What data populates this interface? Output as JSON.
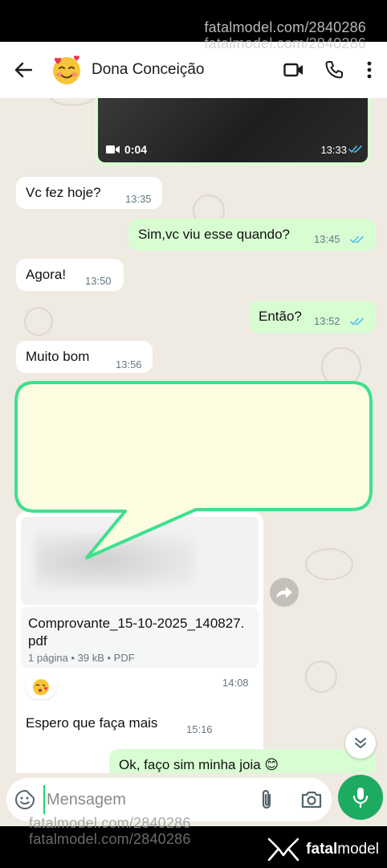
{
  "watermark": {
    "top": "fatalmodel.com/2840286",
    "bottom": "fatalmodel.com/2840286"
  },
  "brand": {
    "bold": "fatal",
    "rest": "model"
  },
  "header": {
    "contact_name": "Dona Conceição",
    "avatar_emoji": "🥰"
  },
  "video": {
    "duration": "0:04",
    "time": "13:33"
  },
  "messages": [
    {
      "dir": "in",
      "text": "Vc fez hoje?",
      "time": "13:35"
    },
    {
      "dir": "out",
      "text": "Sim,vc viu esse quando?",
      "time": "13:45"
    },
    {
      "dir": "in",
      "text": "Agora!",
      "time": "13:50"
    },
    {
      "dir": "out",
      "text": "Então?",
      "time": "13:52"
    },
    {
      "dir": "in",
      "text": "Muito bom",
      "time": "13:56"
    },
    {
      "dir": "in",
      "text": "Espero que faça mais",
      "time": "15:16"
    },
    {
      "dir": "out",
      "text": "Ok, faço sim minha joia 😊",
      "time": ""
    }
  ],
  "document": {
    "filename": "Comprovante_15-10-2025_140827.pdf",
    "meta": "1 página • 39 kB • PDF",
    "time": "14:08",
    "reaction": "😘"
  },
  "input": {
    "placeholder": "Mensagem"
  },
  "colors": {
    "accent": "#1daa61",
    "outgoing": "#d9fdd3",
    "callout_fill": "#fdfde2",
    "callout_border": "#3ee08f",
    "tick_read": "#53bdeb"
  }
}
